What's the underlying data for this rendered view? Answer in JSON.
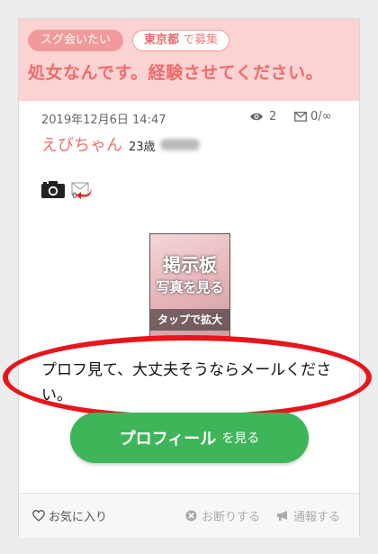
{
  "header": {
    "tag_meet": "スグ会いたい",
    "location": "東京都",
    "recruit_suffix": "で募集",
    "title": "処女なんです。経験させてください。"
  },
  "meta": {
    "date": "2019年12月6日 14:47",
    "views": "2",
    "mail_ratio": "0/∞"
  },
  "user": {
    "name": "えびちゃん",
    "age": "23歳"
  },
  "attachments": {
    "mail_count": "0"
  },
  "photo": {
    "line1": "掲示板",
    "line2": "写真を見る",
    "line3": "タップで拡大"
  },
  "message": "プロフ見て、大丈夫そうならメールください。",
  "profile_button": {
    "main": "プロフィール",
    "sub": "を見る"
  },
  "footer": {
    "favorite": "お気に入り",
    "decline": "お断りする",
    "report": "通報する"
  },
  "colors": {
    "header_bg": "#fcd3d3",
    "accent": "#ef6b6b",
    "button": "#3eb559",
    "highlight_oval": "#e8151b"
  }
}
